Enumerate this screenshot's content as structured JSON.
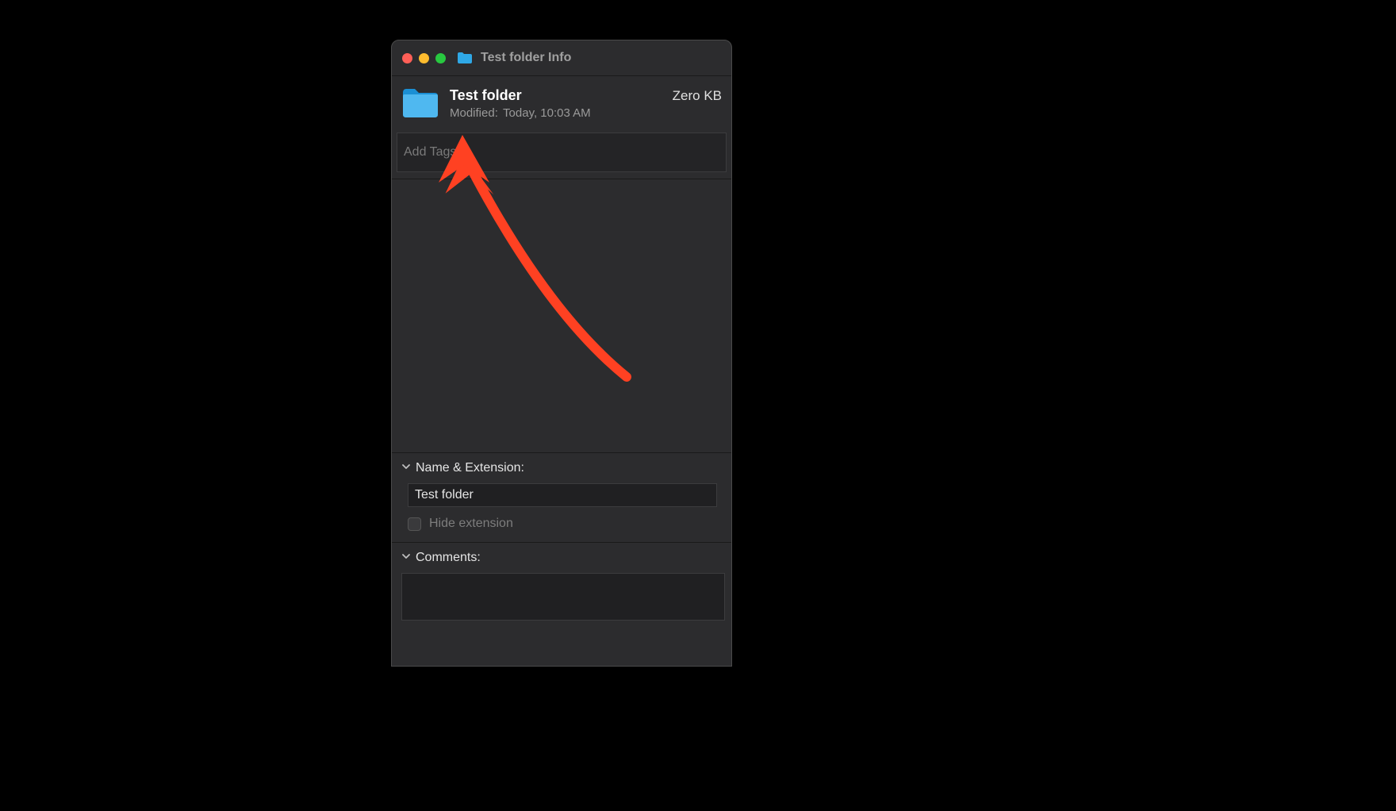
{
  "window": {
    "title": "Test folder Info"
  },
  "header": {
    "name": "Test folder",
    "size": "Zero KB",
    "modified_label": "Modified:",
    "modified_value": "Today, 10:03 AM"
  },
  "tags": {
    "placeholder": "Add Tags…",
    "value": ""
  },
  "sections": {
    "name_ext": {
      "title": "Name & Extension:",
      "value": "Test folder",
      "hide_ext_label": "Hide extension",
      "hide_ext_checked": false
    },
    "comments": {
      "title": "Comments:",
      "value": ""
    }
  },
  "colors": {
    "accent_red": "#ff4122"
  }
}
